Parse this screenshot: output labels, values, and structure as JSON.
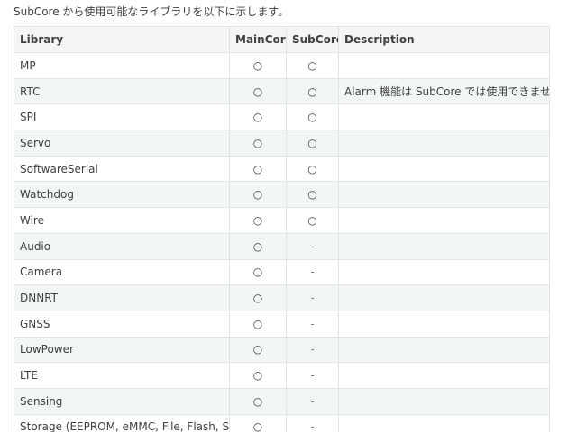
{
  "intro": "SubCore から使用可能なライブラリを以下に示します。",
  "table": {
    "headers": {
      "library": "Library",
      "maincore": "MainCore",
      "subcore": "SubCore",
      "description": "Description"
    },
    "rows": [
      {
        "library": "MP",
        "maincore": "○",
        "subcore": "○",
        "description": ""
      },
      {
        "library": "RTC",
        "maincore": "○",
        "subcore": "○",
        "description": "Alarm 機能は SubCore では使用できません。"
      },
      {
        "library": "SPI",
        "maincore": "○",
        "subcore": "○",
        "description": ""
      },
      {
        "library": "Servo",
        "maincore": "○",
        "subcore": "○",
        "description": ""
      },
      {
        "library": "SoftwareSerial",
        "maincore": "○",
        "subcore": "○",
        "description": ""
      },
      {
        "library": "Watchdog",
        "maincore": "○",
        "subcore": "○",
        "description": ""
      },
      {
        "library": "Wire",
        "maincore": "○",
        "subcore": "○",
        "description": ""
      },
      {
        "library": "Audio",
        "maincore": "○",
        "subcore": "-",
        "description": ""
      },
      {
        "library": "Camera",
        "maincore": "○",
        "subcore": "-",
        "description": ""
      },
      {
        "library": "DNNRT",
        "maincore": "○",
        "subcore": "-",
        "description": ""
      },
      {
        "library": "GNSS",
        "maincore": "○",
        "subcore": "-",
        "description": ""
      },
      {
        "library": "LowPower",
        "maincore": "○",
        "subcore": "-",
        "description": ""
      },
      {
        "library": "LTE",
        "maincore": "○",
        "subcore": "-",
        "description": ""
      },
      {
        "library": "Sensing",
        "maincore": "○",
        "subcore": "-",
        "description": ""
      },
      {
        "library": "Storage (EEPROM, eMMC, File, Flash, SDHCI)",
        "maincore": "○",
        "subcore": "-",
        "description": ""
      }
    ]
  }
}
